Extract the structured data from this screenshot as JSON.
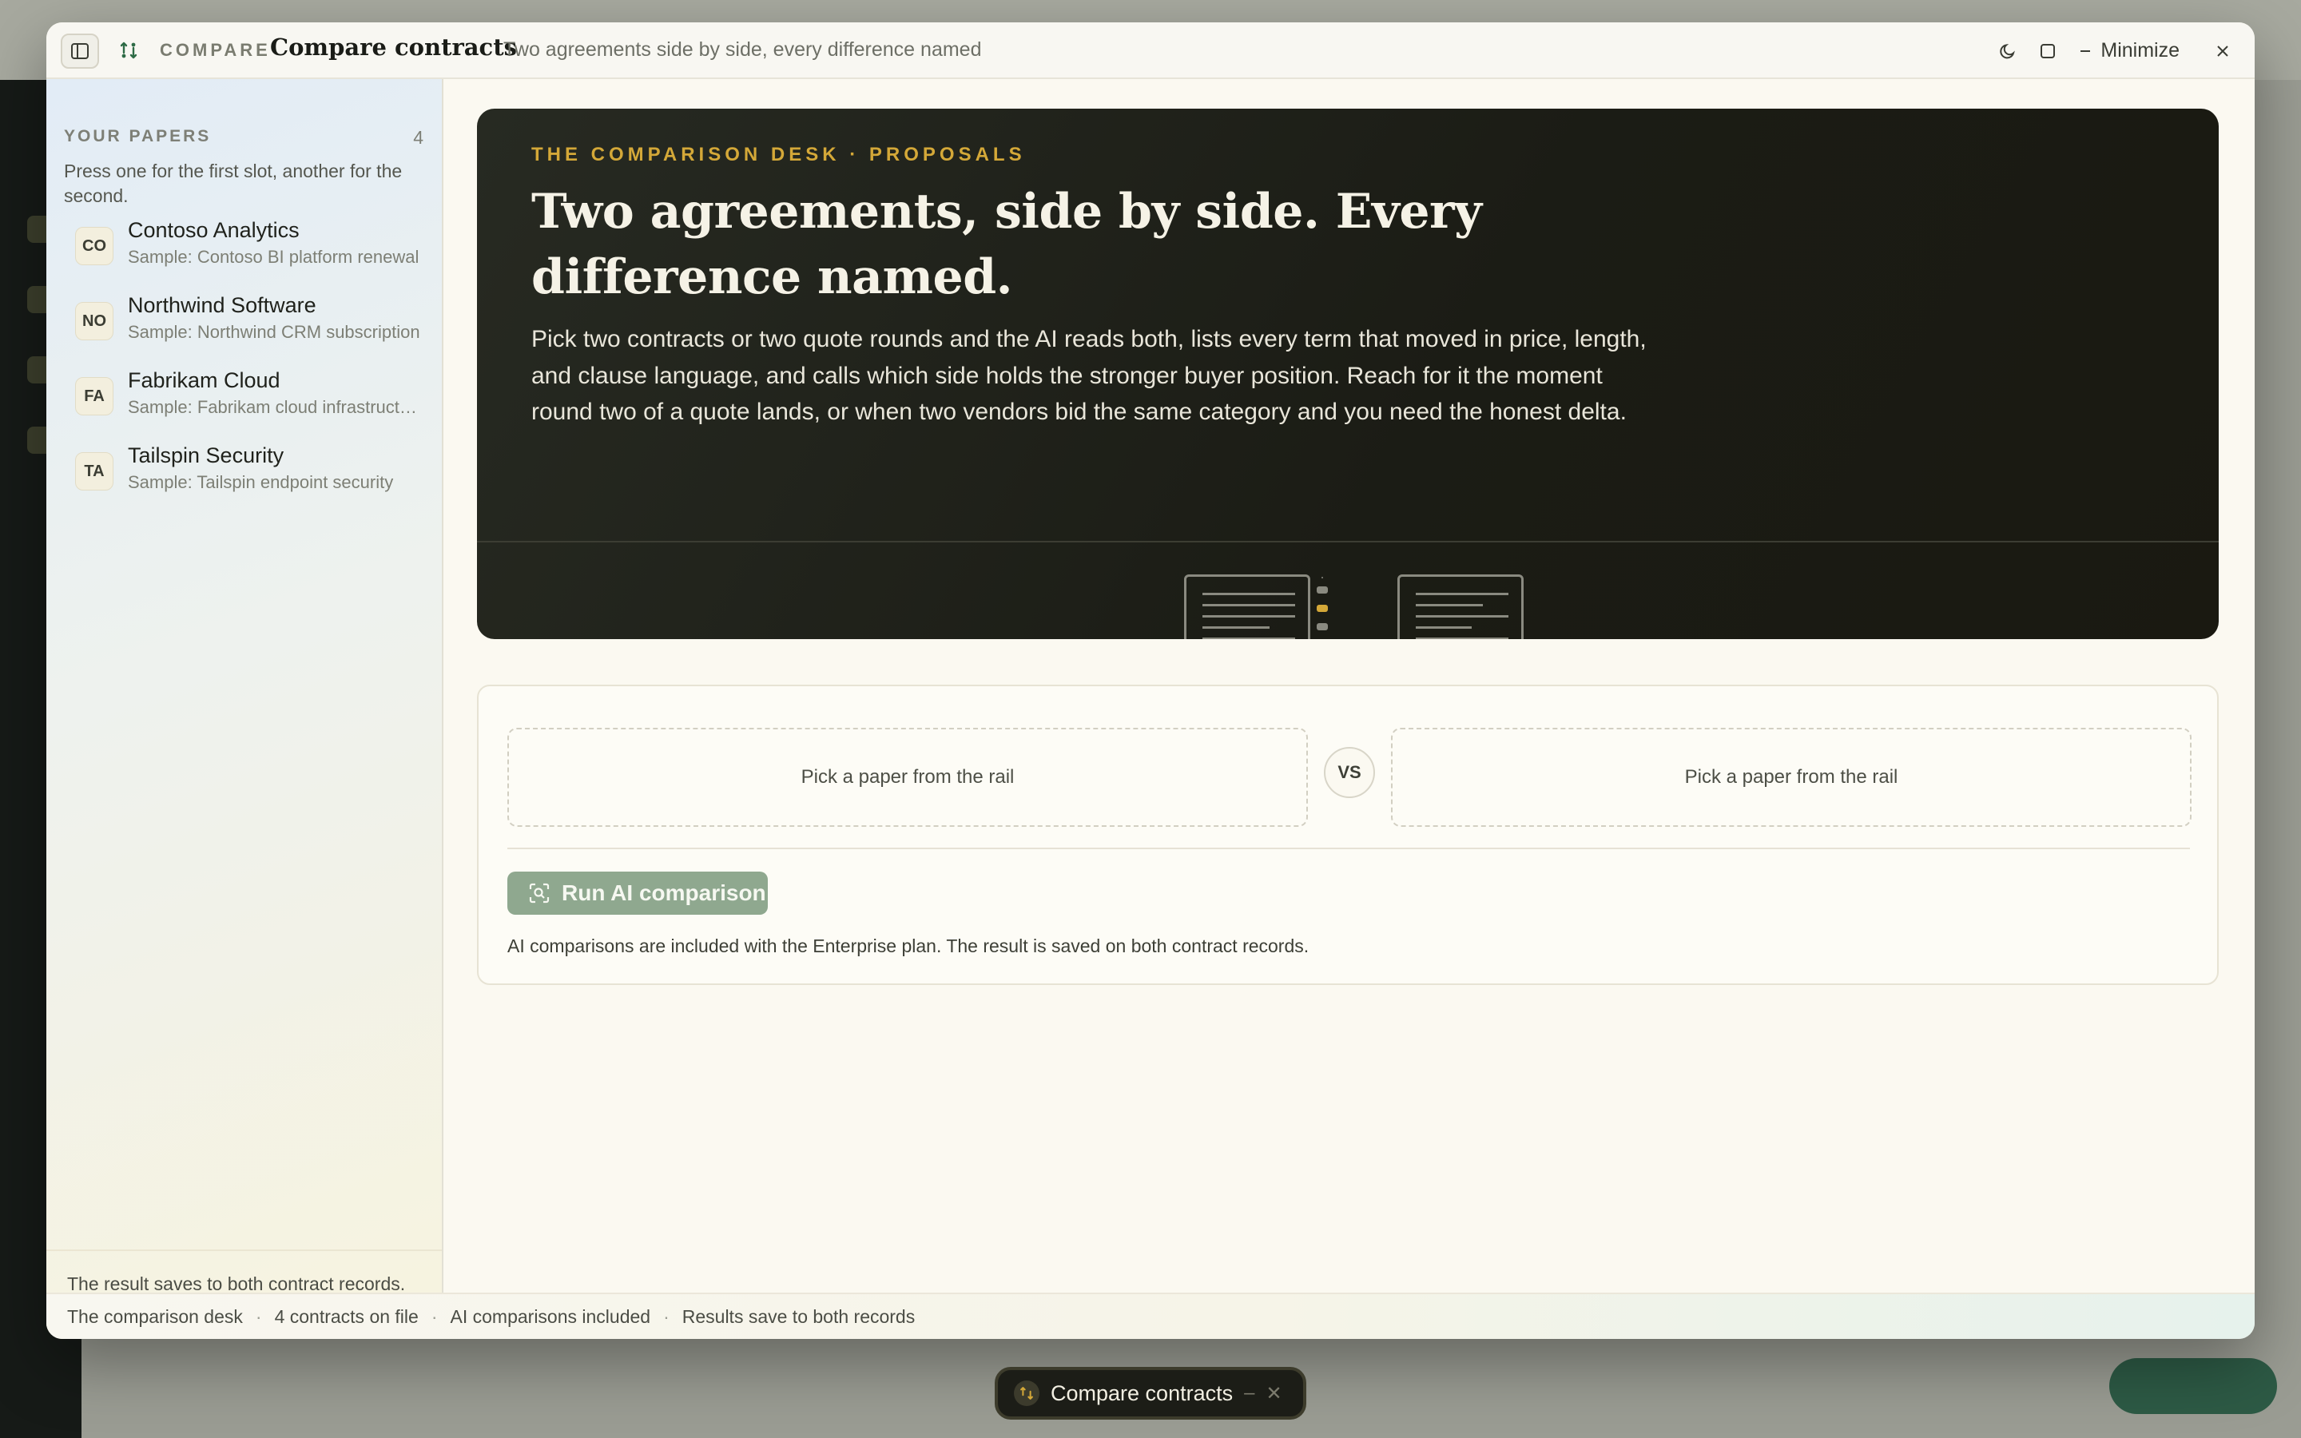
{
  "window": {
    "kicker": "COMPARE",
    "title": "Compare contracts",
    "subtitle": "Two agreements side by side, every difference named",
    "minimize_label": "Minimize"
  },
  "rail": {
    "title": "YOUR PAPERS",
    "count": "4",
    "hint": "Press one for the first slot, another for the second.",
    "papers": [
      {
        "initials": "CO",
        "name": "Contoso Analytics",
        "sample": "Sample: Contoso BI platform renewal"
      },
      {
        "initials": "NO",
        "name": "Northwind Software",
        "sample": "Sample: Northwind CRM subscription"
      },
      {
        "initials": "FA",
        "name": "Fabrikam Cloud",
        "sample": "Sample: Fabrikam cloud infrastructure"
      },
      {
        "initials": "TA",
        "name": "Tailspin Security",
        "sample": "Sample: Tailspin endpoint security"
      }
    ],
    "footer": "The result saves to both contract records."
  },
  "hero": {
    "kicker": "THE COMPARISON DESK · PROPOSALS",
    "title": "Two agreements, side by side. Every difference named.",
    "body": "Pick two contracts or two quote rounds and the AI reads both, lists every term that moved in price, length, and clause language, and calls which side holds the stronger buyer position. Reach for it the moment round two of a quote lands, or when two vendors bid the same category and you need the honest delta."
  },
  "compare": {
    "slot_a": "Pick a paper from the rail",
    "vs": "VS",
    "slot_b": "Pick a paper from the rail",
    "run_label": "Run AI comparison",
    "note": "AI comparisons are included with the Enterprise plan. The result is saved on both contract records."
  },
  "status": {
    "items": [
      "The comparison desk",
      "4 contracts on file",
      "AI comparisons included",
      "Results save to both records"
    ],
    "separator": "·"
  },
  "dock_chip": {
    "label": "Compare contracts"
  },
  "colors": {
    "accent_gold": "#d4a838",
    "hero_bg": "#1b1c15",
    "run_button": "#8fa88f"
  }
}
